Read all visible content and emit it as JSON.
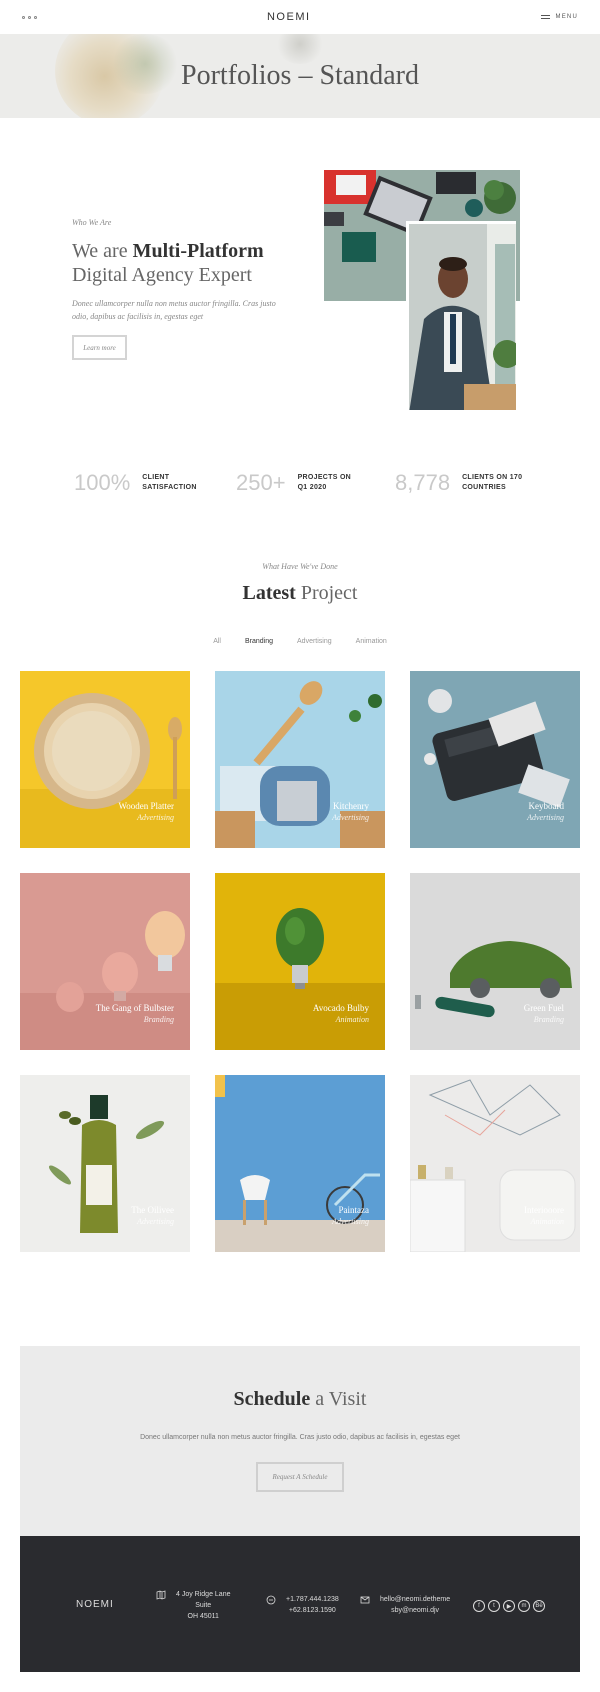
{
  "header": {
    "logo": "NOEMI",
    "menu_label": "MENU"
  },
  "titlebar": {
    "title": "Portfolios – Standard"
  },
  "intro": {
    "eyebrow": "Who We Are",
    "heading_pre": "We are",
    "heading_bold": "Multi-Platform",
    "heading_line2": "Digital Agency Expert",
    "text": "Donec ullamcorper nulla non metus auctor fringilla. Cras justo odio, dapibus ac facilisis in, egestas eget",
    "button": "Learn more"
  },
  "stats": [
    {
      "number": "100%",
      "label": "CLIENT SATISFACTION"
    },
    {
      "number": "250+",
      "label": "PROJECTS ON Q1 2020"
    },
    {
      "number": "8,778",
      "label": "CLIENTS ON 170 COUNTRIES"
    }
  ],
  "projects_section": {
    "eyebrow": "What Have We've Done",
    "title_bold": "Latest",
    "title_rest": "Project",
    "filters": [
      "All",
      "Branding",
      "Advertising",
      "Animation"
    ]
  },
  "projects": [
    {
      "title": "Wooden Platter",
      "category": "Advertising",
      "bg": "#f5c72a"
    },
    {
      "title": "Kitchenry",
      "category": "Advertising",
      "bg": "#a9d5e8"
    },
    {
      "title": "Keyboard",
      "category": "Advertising",
      "bg": "#7fa6b4"
    },
    {
      "title": "The Gang of Bulbster",
      "category": "Branding",
      "bg": "#d99a92"
    },
    {
      "title": "Avocado Bulby",
      "category": "Animation",
      "bg": "#e1b40a"
    },
    {
      "title": "Green Fuel",
      "category": "Branding",
      "bg": "#d9d9d9"
    },
    {
      "title": "The Oilivee",
      "category": "Advertising",
      "bg": "#eeeeec"
    },
    {
      "title": "Paintaza",
      "category": "Advertising",
      "bg": "#5c9ed4"
    },
    {
      "title": "Interiooore",
      "category": "Animation",
      "bg": "#ecebea"
    }
  ],
  "cta": {
    "title_bold": "Schedule",
    "title_rest": "a Visit",
    "text": "Donec ullamcorper nulla non metus auctor fringilla. Cras justo odio, dapibus ac facilisis in, egestas eget",
    "button": "Request A Schedule"
  },
  "footer": {
    "logo": "NOEMI",
    "address_line1": "4 Joy Ridge Lane",
    "address_line2": "Suite",
    "address_line3": "OH 45011",
    "phone1": "+1.787.444.1238",
    "phone2": "+62.8123.1590",
    "email1": "hello@neomi.detheme",
    "email2": "sby@neomi.djv",
    "social": [
      "facebook-icon",
      "twitter-icon",
      "youtube-icon",
      "messenger-icon",
      "behance-icon"
    ]
  }
}
